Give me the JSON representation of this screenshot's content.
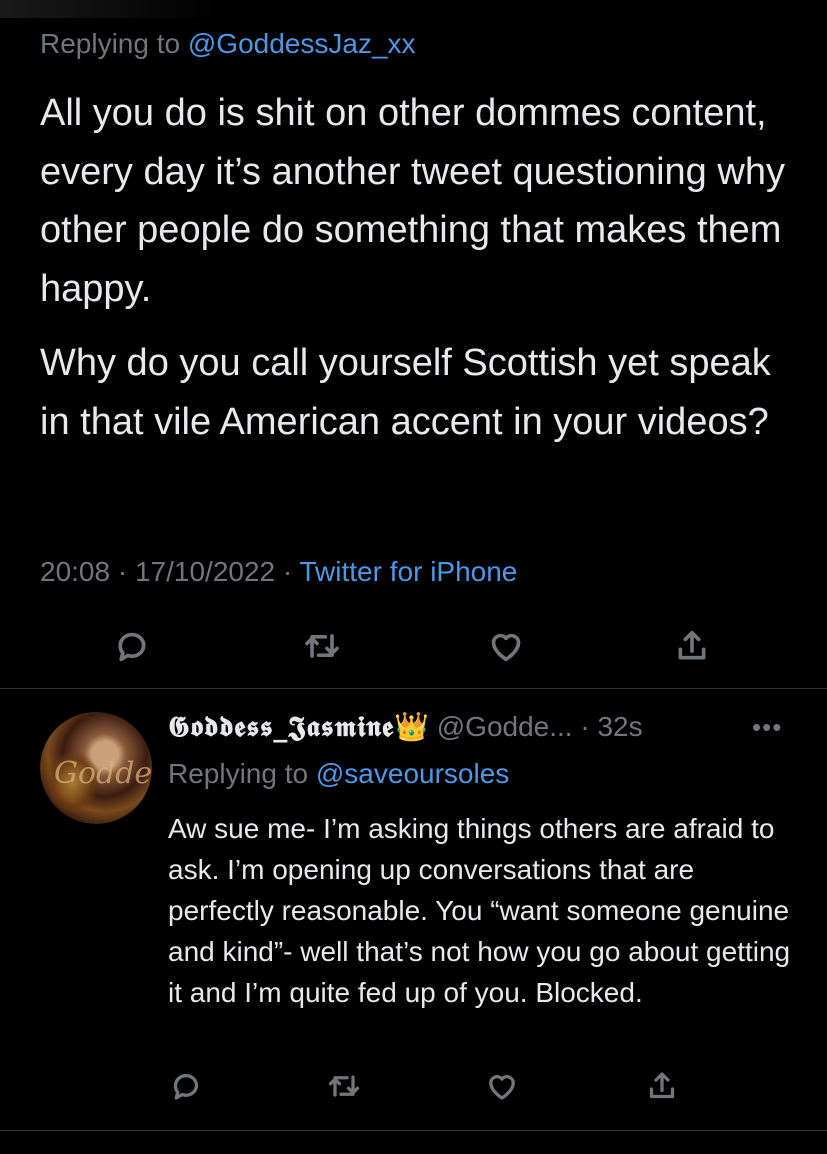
{
  "main_tweet": {
    "replying_prefix": "Replying to",
    "replying_handle": "@GoddessJaz_xx",
    "paragraphs": [
      "All you do is shit on other dommes content, every day it’s another tweet questioning why other people do something that makes them happy.",
      "Why do you call yourself Scottish yet speak in that vile American accent in your videos?"
    ],
    "time": "20:08",
    "separator": " · ",
    "date": "17/10/2022",
    "source": "Twitter for iPhone",
    "actions": [
      "reply-icon",
      "retweet-icon",
      "like-icon",
      "share-icon"
    ]
  },
  "reply_tweet": {
    "display_name": "𝕲𝖔𝖉𝖉𝖊𝖘𝖘_𝕵𝖆𝖘𝖒𝖎𝖓𝖊",
    "badge": "👑",
    "handle": "@Godde...",
    "time_sep": " · ",
    "time": "32s",
    "more": "•••",
    "replying_prefix": "Replying to",
    "replying_handle": "@saveoursoles",
    "text": "Aw sue me- I’m asking things others are afraid to ask. I’m opening up conversations that are perfectly reasonable. You “want someone genuine and kind”- well that’s not how you go about getting it and I’m quite fed up of you. Blocked.",
    "avatar_script": "Goddess",
    "actions": [
      "reply-icon",
      "retweet-icon",
      "like-icon",
      "share-icon"
    ]
  },
  "colors": {
    "background": "#000000",
    "text": "#e7e9ea",
    "muted": "#71767b",
    "link": "#4a99e9",
    "divider": "#2f3336"
  }
}
